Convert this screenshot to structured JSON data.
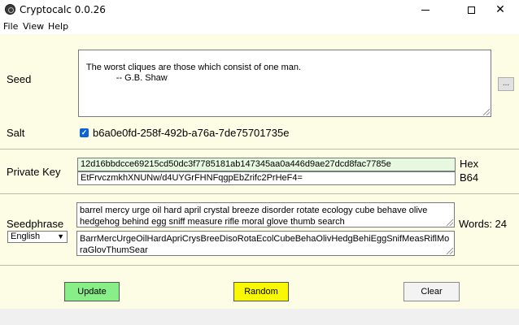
{
  "window": {
    "title": "Cryptocalc 0.0.26",
    "minimize_glyph": "",
    "close_glyph": "✕"
  },
  "menu": {
    "file": "File",
    "view": "View",
    "help": "Help"
  },
  "seed": {
    "label": "Seed",
    "text": "The worst cliques are those which consist of one man.\n              -- G.B. Shaw",
    "browse_label": "..."
  },
  "salt": {
    "label": "Salt",
    "checked": true,
    "check_glyph": "✓",
    "value": "b6a0e0fd-258f-492b-a76a-7de75701735e"
  },
  "private_key": {
    "label": "Private Key",
    "hex_value": "12d16bbdcce69215cd50dc3f7785181ab147345aa0a446d9ae27dcd8fac7785e",
    "hex_unit": "Hex",
    "b64_value": "EtFrvczmkhXNUNw/d4UYGrFHNFqgpEbZrifc2PrHeF4=",
    "b64_unit": "B64"
  },
  "seedphrase": {
    "label": "Seedphrase",
    "language": "English",
    "words": "barrel mercy urge oil hard april crystal breeze disorder rotate ecology cube behave olive hedgehog behind egg sniff measure rifle moral glove thumb search",
    "compact": "BarrMercUrgeOilHardApriCrysBreeDisoRotaEcolCubeBehaOlivHedgBehiEggSnifMeasRiflMoraGlovThumSear",
    "word_count_label": "Words: 24"
  },
  "buttons": {
    "update": "Update",
    "random": "Random",
    "clear": "Clear"
  },
  "colors": {
    "background": "#fdfde6",
    "update_button": "#88ee88",
    "random_button": "#f8f800",
    "hex_field": "#e6f8e0"
  }
}
